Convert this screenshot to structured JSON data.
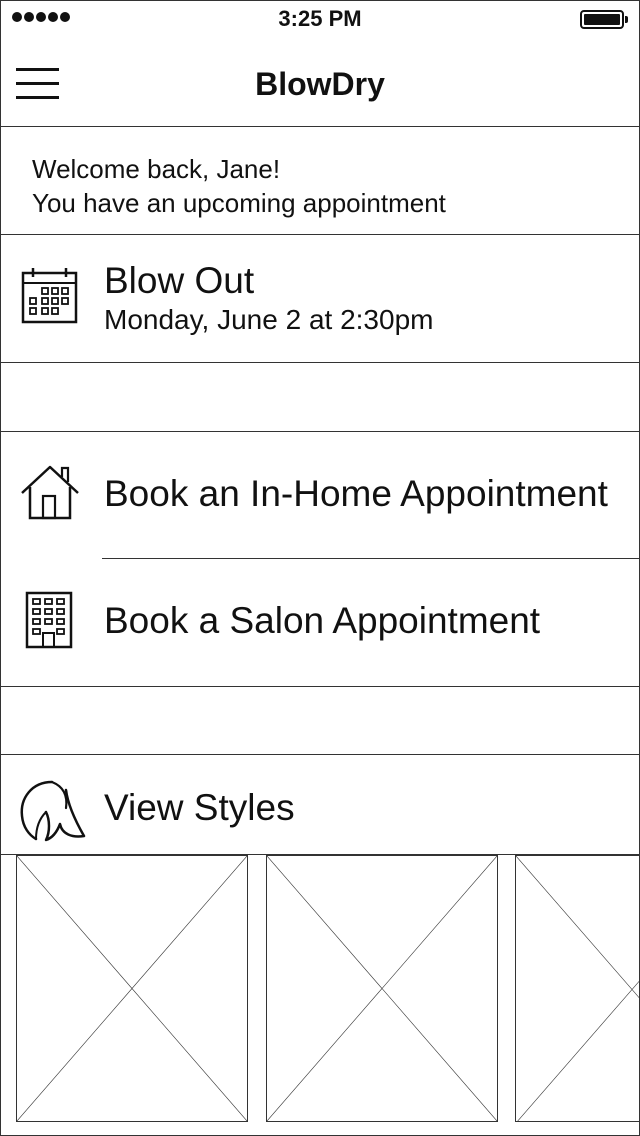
{
  "status_bar": {
    "time": "3:25 PM",
    "signal_dots": 5
  },
  "header": {
    "title": "BlowDry",
    "menu_icon": "hamburger-menu-icon"
  },
  "welcome": {
    "line1": "Welcome back, Jane!",
    "line2": "You have an upcoming appointment"
  },
  "appointment": {
    "icon": "calendar-icon",
    "title": "Blow Out",
    "date": "Monday, June 2 at 2:30pm"
  },
  "booking": [
    {
      "icon": "house-icon",
      "label": "Book an In-Home Appointment"
    },
    {
      "icon": "building-icon",
      "label": "Book a Salon Appointment"
    }
  ],
  "styles": {
    "icon": "hair-silhouette-icon",
    "label": "View Styles",
    "thumbnails": 3
  }
}
